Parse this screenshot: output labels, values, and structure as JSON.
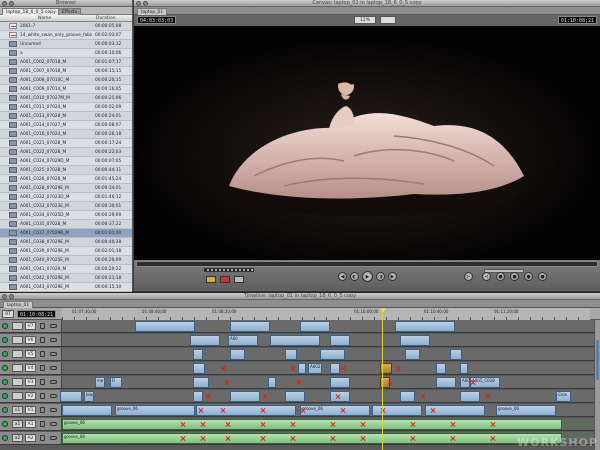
{
  "browser": {
    "title": "Browser",
    "tabs": [
      "laptop_18_6_0_5 copy",
      "Effects"
    ],
    "columns": {
      "name": "Name",
      "duration": "Duration"
    },
    "items": [
      {
        "name": "2061-7",
        "duration": "00:00:05;08",
        "kind": "sequence"
      },
      {
        "name": "14_white_swan_only_groove_fabio",
        "duration": "00:02:03;07",
        "kind": "sequence"
      },
      {
        "name": "Unnamed",
        "duration": "00:00:03;12",
        "kind": "clip"
      },
      {
        "name": "a",
        "duration": "00:00:10;06",
        "kind": "clip"
      },
      {
        "name": "A001_C002_07018_M",
        "duration": "00:01:07;17",
        "kind": "clip"
      },
      {
        "name": "A001_C007_07018_M",
        "duration": "00:00:15;15",
        "kind": "clip"
      },
      {
        "name": "A001_C008_07010C_M",
        "duration": "00:00:20;15",
        "kind": "clip"
      },
      {
        "name": "A001_C009_07014_M",
        "duration": "00:00:16;05",
        "kind": "clip"
      },
      {
        "name": "A001_C010_07027M_M",
        "duration": "00:00:25;06",
        "kind": "clip"
      },
      {
        "name": "A001_C011_07024_M",
        "duration": "00:00:02;09",
        "kind": "clip"
      },
      {
        "name": "A001_C013_07028_M",
        "duration": "00:00:24;01",
        "kind": "clip"
      },
      {
        "name": "A001_C014_07027_M",
        "duration": "00:00:08;07",
        "kind": "clip"
      },
      {
        "name": "A001_C016_07024_M",
        "duration": "00:00:26;18",
        "kind": "clip"
      },
      {
        "name": "A001_C021_07028_M",
        "duration": "00:00:17;24",
        "kind": "clip"
      },
      {
        "name": "A001_C022_07028_M",
        "duration": "00:00:22;03",
        "kind": "clip"
      },
      {
        "name": "A001_C024_07029D_M",
        "duration": "00:00:07;05",
        "kind": "clip"
      },
      {
        "name": "A001_C025_07028_M",
        "duration": "00:00:44;11",
        "kind": "clip"
      },
      {
        "name": "A001_C026_07028_M",
        "duration": "00:01:45;24",
        "kind": "clip"
      },
      {
        "name": "A001_C028_07029E_M",
        "duration": "00:00:34;01",
        "kind": "clip"
      },
      {
        "name": "A001_C032_07023D_M",
        "duration": "00:01:46;12",
        "kind": "clip"
      },
      {
        "name": "A001_C033_07023E_M",
        "duration": "00:00:30;01",
        "kind": "clip"
      },
      {
        "name": "A001_C034_07025D_M",
        "duration": "00:00:29;09",
        "kind": "clip"
      },
      {
        "name": "A001_C035_07028_M",
        "duration": "00:00:37;22",
        "kind": "clip"
      },
      {
        "name": "A001_C037_07029B_M",
        "duration": "00:01:01;00",
        "kind": "clip",
        "selected": true
      },
      {
        "name": "A001_C038_07029E_M",
        "duration": "00:00:40;28",
        "kind": "clip"
      },
      {
        "name": "A001_C039_07029E_M",
        "duration": "00:02:01;18",
        "kind": "clip"
      },
      {
        "name": "A001_C040_07025E_M",
        "duration": "00:00:20;09",
        "kind": "clip"
      },
      {
        "name": "A001_C041_07029_M",
        "duration": "00:00:20;22",
        "kind": "clip"
      },
      {
        "name": "A001_C042_07029E_M",
        "duration": "00:00:21;18",
        "kind": "clip"
      },
      {
        "name": "A001_C043_07029E_M",
        "duration": "00:00:15;10",
        "kind": "clip"
      },
      {
        "name": "A001_C044_07029E_M",
        "duration": "00:00:11;04",
        "kind": "clip"
      }
    ]
  },
  "canvas": {
    "title": "Canvas: laptop_01 in laptop_18_6_0_5 copy",
    "tab": "laptop_01",
    "timecode_duration": "04:03:03;03",
    "timecode_current": "01:10:08;21",
    "zoom": "12%"
  },
  "timeline": {
    "title": "Timeline: laptop_01 in laptop_18_6_0_5 copy",
    "tab": "laptop_01",
    "rt_label": "RT",
    "timecode": "01:10:08;21",
    "ruler_labels": [
      "01:07:30;00",
      "01:08:40;00",
      "01:08:20;00",
      "01:10:00;00",
      "01:10:40;00",
      "01:11:20;00"
    ],
    "tracks": [
      {
        "id": "V7",
        "patch": ""
      },
      {
        "id": "V6",
        "patch": ""
      },
      {
        "id": "V5",
        "patch": ""
      },
      {
        "id": "V4",
        "patch": ""
      },
      {
        "id": "V3",
        "patch": ""
      },
      {
        "id": "V2",
        "patch": ""
      },
      {
        "id": "V1",
        "patch": "v1"
      },
      {
        "id": "A1",
        "patch": "a1"
      },
      {
        "id": "A2",
        "patch": "a2"
      }
    ],
    "clip_labels": {
      "v1_main": "A001_C007_0701PB_M i-100",
      "v1_groove": "groove_06",
      "v1_black": "black",
      "v2_mo": "mo",
      "v2_fi": "Fi",
      "v3_a005": "A005_C01",
      "v3_a005b": "A005_C018",
      "v4_a002": "A002",
      "v6_a00": "A00",
      "a_groove": "groove_06",
      "cross": "Cros"
    }
  },
  "watermark": "WORKSHOP"
}
